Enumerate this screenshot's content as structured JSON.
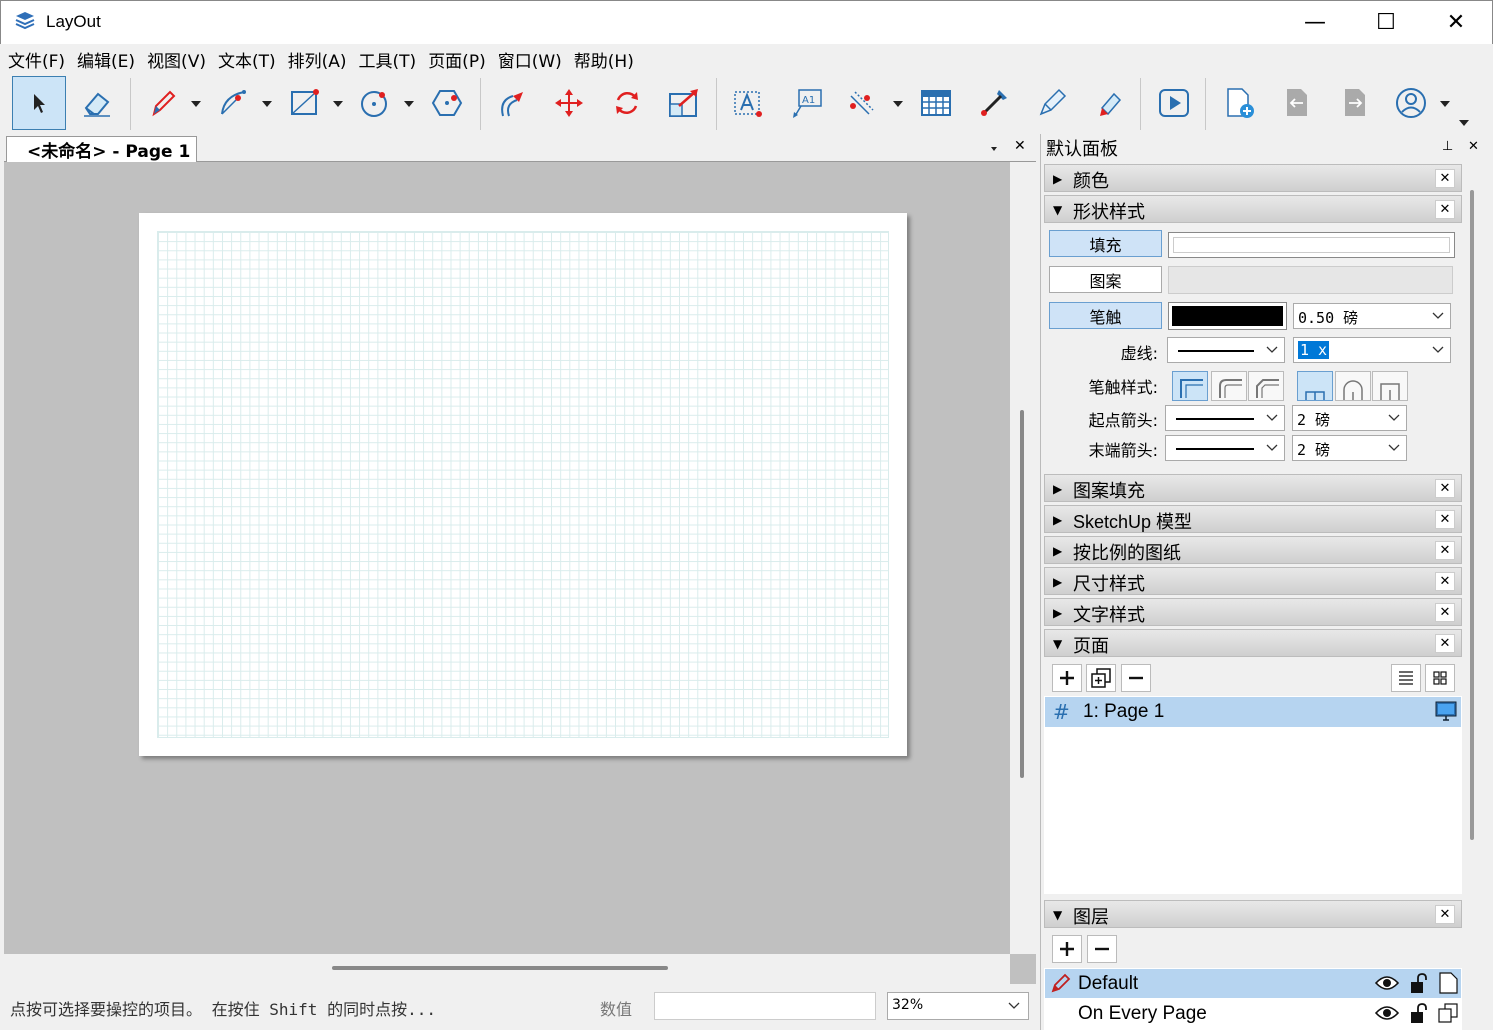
{
  "window": {
    "title": "LayOut",
    "minimize": "—",
    "maximize": "☐",
    "close": "✕"
  },
  "menu": [
    "文件(F)",
    "编辑(E)",
    "视图(V)",
    "文本(T)",
    "排列(A)",
    "工具(T)",
    "页面(P)",
    "窗口(W)",
    "帮助(H)"
  ],
  "toolbar": {
    "icons": [
      "select-icon",
      "eraser-icon",
      "pencil-icon",
      "arc-icon",
      "rectangle-icon",
      "circle-icon",
      "polygon-icon",
      "offset-icon",
      "move-icon",
      "rotate-icon",
      "scale-icon",
      "text-icon",
      "label-icon",
      "dimension-icon",
      "table-icon",
      "style-picker-icon",
      "split-icon",
      "join-icon",
      "presentation-icon",
      "add-page-icon",
      "previous-page-icon",
      "next-page-icon",
      "account-icon"
    ]
  },
  "document": {
    "tab_label": "<未命名> - Page 1"
  },
  "status": {
    "hint": "点按可选择要操控的项目。 在按住 Shift 的同时点按...",
    "value_label": "数值",
    "value": "",
    "zoom": "32%"
  },
  "panel": {
    "title": "默认面板",
    "sections": {
      "color": "颜色",
      "shape_style": "形状样式",
      "pattern_fill": "图案填充",
      "sketchup_model": "SketchUp 模型",
      "scaled_drawing": "按比例的图纸",
      "dimension_style": "尺寸样式",
      "text_style": "文字样式",
      "pages": "页面",
      "layers": "图层"
    },
    "shape": {
      "fill_label": "填充",
      "pattern_label": "图案",
      "stroke_label": "笔触",
      "stroke_width": "0.50 磅",
      "dash_label": "虚线:",
      "dash_scale": "1 x",
      "stroke_style_label": "笔触样式:",
      "start_arrow_label": "起点箭头:",
      "start_arrow_size": "2 磅",
      "end_arrow_label": "末端箭头:",
      "end_arrow_size": "2 磅",
      "stroke_color": "#000000"
    },
    "pages_list": [
      {
        "number": "#",
        "name": "1: Page 1"
      }
    ],
    "layers_list": [
      {
        "name": "Default"
      },
      {
        "name": "On Every Page"
      }
    ]
  }
}
